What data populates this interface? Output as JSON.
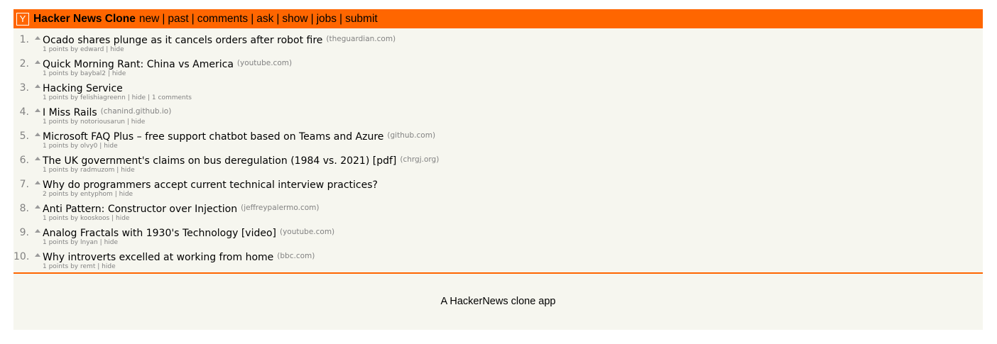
{
  "header": {
    "logo": "Y",
    "site_name": "Hacker News Clone",
    "nav": [
      "new",
      "past",
      "comments",
      "ask",
      "show",
      "jobs",
      "submit"
    ],
    "separator": "|"
  },
  "stories": [
    {
      "rank": "1.",
      "title": "Ocado shares plunge as it cancels orders after robot fire",
      "domain": "(theguardian.com)",
      "points": "1 points by",
      "user": "edward",
      "hide": "hide",
      "comments": ""
    },
    {
      "rank": "2.",
      "title": "Quick Morning Rant: China vs America",
      "domain": "(youtube.com)",
      "points": "1 points by",
      "user": "baybal2",
      "hide": "hide",
      "comments": ""
    },
    {
      "rank": "3.",
      "title": "Hacking Service",
      "domain": "",
      "points": "1 points by",
      "user": "felishiagreenn",
      "hide": "hide",
      "comments": "1 comments"
    },
    {
      "rank": "4.",
      "title": "I Miss Rails",
      "domain": "(chanind.github.io)",
      "points": "1 points by",
      "user": "notoriousarun",
      "hide": "hide",
      "comments": ""
    },
    {
      "rank": "5.",
      "title": "Microsoft FAQ Plus – free support chatbot based on Teams and Azure",
      "domain": "(github.com)",
      "points": "1 points by",
      "user": "olvy0",
      "hide": "hide",
      "comments": ""
    },
    {
      "rank": "6.",
      "title": "The UK government's claims on bus deregulation (1984 vs. 2021) [pdf]",
      "domain": "(chrgj.org)",
      "points": "1 points by",
      "user": "radmuzom",
      "hide": "hide",
      "comments": ""
    },
    {
      "rank": "7.",
      "title": "Why do programmers accept current technical interview practices?",
      "domain": "",
      "points": "2 points by",
      "user": "entyphom",
      "hide": "hide",
      "comments": ""
    },
    {
      "rank": "8.",
      "title": "Anti Pattern: Constructor over Injection",
      "domain": "(jeffreypalermo.com)",
      "points": "1 points by",
      "user": "kooskoos",
      "hide": "hide",
      "comments": ""
    },
    {
      "rank": "9.",
      "title": "Analog Fractals with 1930's Technology [video]",
      "domain": "(youtube.com)",
      "points": "1 points by",
      "user": "lnyan",
      "hide": "hide",
      "comments": ""
    },
    {
      "rank": "10.",
      "title": "Why introverts excelled at working from home",
      "domain": "(bbc.com)",
      "points": "1 points by",
      "user": "remt",
      "hide": "hide",
      "comments": ""
    }
  ],
  "footer": {
    "text": "A HackerNews clone app"
  },
  "colors": {
    "accent": "#ff6600",
    "background": "#f6f6ef",
    "muted": "#828282"
  }
}
